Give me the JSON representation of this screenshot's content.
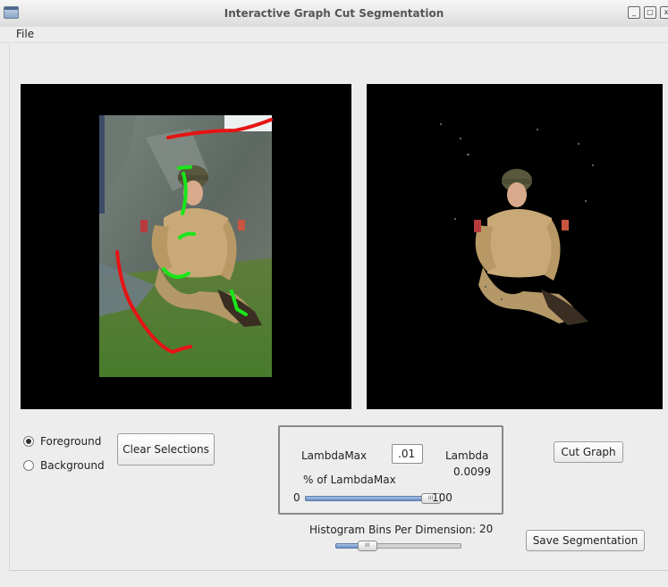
{
  "window": {
    "title": "Interactive Graph Cut Segmentation",
    "controls": [
      "_",
      "□",
      "x"
    ]
  },
  "menu": {
    "file": "File"
  },
  "mode": {
    "foreground": "Foreground",
    "background": "Background",
    "selected": "Foreground"
  },
  "buttons": {
    "clear": "Clear Selections",
    "cut": "Cut Graph",
    "save": "Save Segmentation"
  },
  "lambda": {
    "max_label": "LambdaMax",
    "max_value": ".01",
    "label": "Lambda",
    "value": "0.0099",
    "percent_label": "% of LambdaMax",
    "slider_min": "0",
    "slider_max": "100",
    "slider_value_percent": 99
  },
  "histogram": {
    "label": "Histogram Bins Per Dimension:",
    "value": "20",
    "slider_fraction": 0.25
  },
  "icons": {
    "app": "app-window-icon",
    "slider_grip": "III"
  },
  "colors": {
    "foreground_stroke": "#19e619",
    "background_stroke": "#e61414",
    "accent": "#6b8fc3"
  }
}
